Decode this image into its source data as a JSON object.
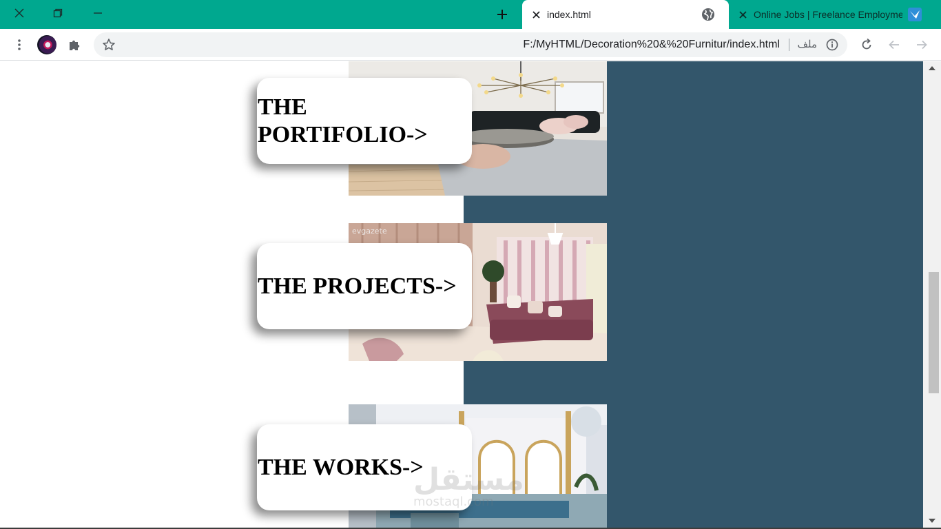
{
  "browser": {
    "accent_color": "#00a88f",
    "window_controls": [
      "close-icon",
      "restore-icon",
      "minimize-icon"
    ],
    "new_tab_icon": "plus-icon",
    "tabs": [
      {
        "title": "index.html",
        "favicon": "globe-icon",
        "active": true
      },
      {
        "title": "Online Jobs | Freelance Employment",
        "favicon": "mostaql-bird-icon",
        "active": false
      }
    ],
    "toolbar": {
      "menu_icon": "kebab-menu-icon",
      "extensions_icon": "puzzle-piece-icon",
      "bookmark_icon": "star-icon",
      "url": "F:/MyHTML/Decoration%20&%20Furnitur/index.html",
      "scheme_label": "ملف",
      "info_icon": "info-icon",
      "reload_icon": "reload-icon",
      "back_icon": "arrow-left-icon",
      "forward_icon": "arrow-right-icon"
    }
  },
  "page": {
    "panel_color": "#33566b",
    "cards": [
      {
        "label": "THE PORTIFOLIO->",
        "image": "living-room-chandelier"
      },
      {
        "label": "THE PROJECTS->",
        "image": "pink-sofa-room",
        "image_text": "evgazete"
      },
      {
        "label": "THE WORKS->",
        "image": "arched-majlis-room"
      }
    ],
    "watermark": {
      "line1": "مستقل",
      "line2": "mostaql.com"
    }
  }
}
